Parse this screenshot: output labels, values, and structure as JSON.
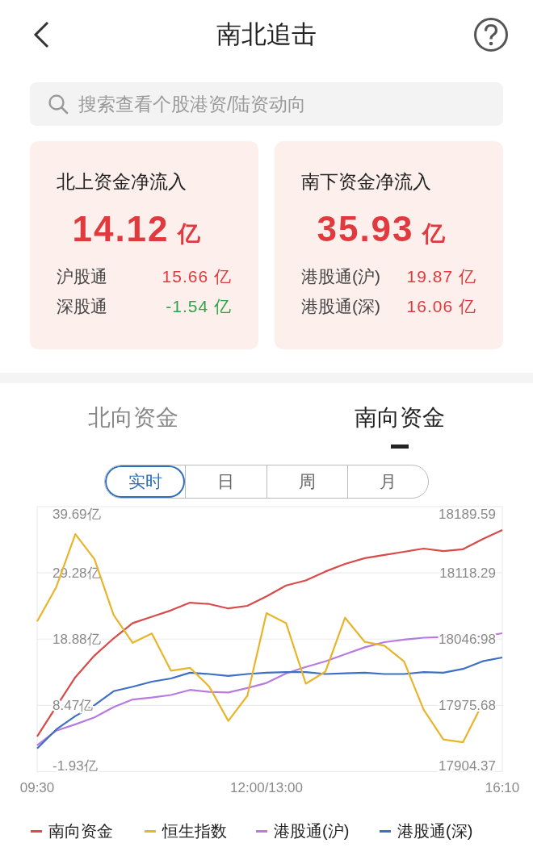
{
  "header": {
    "title": "南北追击"
  },
  "search": {
    "placeholder": "搜索查看个股港资/陆资动向"
  },
  "cards": [
    {
      "title": "北上资金净流入",
      "total": "14.12",
      "unit": "亿",
      "rows": [
        {
          "label": "沪股通",
          "value": "15.66 亿",
          "color": "#e0393e"
        },
        {
          "label": "深股通",
          "value": "-1.54 亿",
          "color": "#2fa24a"
        }
      ]
    },
    {
      "title": "南下资金净流入",
      "total": "35.93",
      "unit": "亿",
      "rows": [
        {
          "label": "港股通(沪)",
          "value": "19.87 亿",
          "color": "#e0393e"
        },
        {
          "label": "港股通(深)",
          "value": "16.06 亿",
          "color": "#e0393e"
        }
      ]
    }
  ],
  "tabs": [
    {
      "label": "北向资金",
      "selected": false
    },
    {
      "label": "南向资金",
      "selected": true
    }
  ],
  "periods": [
    {
      "label": "实时",
      "selected": true
    },
    {
      "label": "日",
      "selected": false
    },
    {
      "label": "周",
      "selected": false
    },
    {
      "label": "月",
      "selected": false
    }
  ],
  "chart": {
    "chart_data": {
      "type": "line",
      "grid": true,
      "categories": [
        "09:30",
        null,
        null,
        null,
        null,
        null,
        null,
        null,
        null,
        null,
        null,
        null,
        "12:00/13:00",
        null,
        null,
        null,
        null,
        null,
        null,
        null,
        null,
        null,
        null,
        null,
        "16:10"
      ],
      "ylim": [
        -1.93,
        39.69
      ],
      "yticks": [
        {
          "value": 39.69,
          "label": "39.69亿"
        },
        {
          "value": 29.28,
          "label": "29.28亿"
        },
        {
          "value": 18.88,
          "label": "18.88亿"
        },
        {
          "value": 8.47,
          "label": "8.47亿"
        },
        {
          "value": -1.93,
          "label": "-1.93亿"
        }
      ],
      "series": [
        {
          "name": "南向资金",
          "color": "#d94a4a",
          "values": [
            3.6,
            8.3,
            12.9,
            16.3,
            19.0,
            21.4,
            22.4,
            23.4,
            24.6,
            24.4,
            23.7,
            24.1,
            25.6,
            27.3,
            28.1,
            29.5,
            30.7,
            31.6,
            32.1,
            32.6,
            33.1,
            32.7,
            33.0,
            34.6,
            36.0
          ]
        },
        {
          "name": "港股通(沪)",
          "color": "#b77be0",
          "values": [
            2.2,
            4.5,
            5.5,
            6.6,
            8.2,
            9.4,
            9.7,
            10.1,
            10.9,
            10.6,
            10.5,
            11.2,
            12.0,
            13.5,
            14.5,
            15.4,
            16.5,
            17.6,
            18.4,
            18.8,
            19.1,
            19.2,
            19.2,
            19.3,
            19.8
          ]
        },
        {
          "name": "港股通(深)",
          "color": "#3d6fc4",
          "values": [
            1.7,
            4.7,
            6.8,
            8.5,
            10.7,
            11.4,
            12.2,
            12.7,
            13.6,
            13.4,
            13.1,
            13.4,
            13.6,
            13.7,
            13.7,
            13.4,
            13.5,
            13.6,
            13.4,
            13.4,
            13.7,
            13.6,
            14.2,
            15.4,
            16.0
          ]
        }
      ]
    }
  },
  "index_chart": {
    "chart_data": {
      "type": "line",
      "ylim": [
        17904.37,
        18189.59
      ],
      "yticks": [
        {
          "value": 18189.59,
          "label": "18189.59"
        },
        {
          "value": 18118.29,
          "label": "18118.29"
        },
        {
          "value": 18046.98,
          "label": "18046.98"
        },
        {
          "value": 17975.68,
          "label": "17975.68"
        },
        {
          "value": 17904.37,
          "label": "17904.37"
        }
      ],
      "series": [
        {
          "name": "恒生指数",
          "color": "#e8b52a",
          "values": [
            18066,
            18103,
            18160,
            18133,
            18073,
            18043,
            18053,
            18013,
            18016,
            17996,
            17959,
            17986,
            18075,
            18064,
            17999,
            18012,
            18070,
            18044,
            18040,
            18023,
            17971,
            17939,
            17936,
            17978
          ]
        }
      ]
    }
  }
}
